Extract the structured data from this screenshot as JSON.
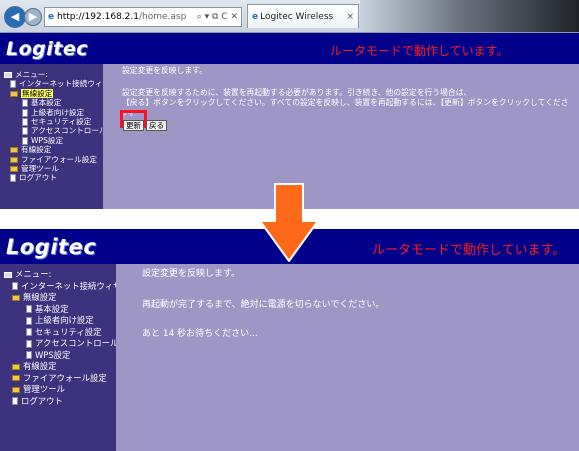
{
  "browser": {
    "url_host": "http://192.168.2.1",
    "url_path": "/home.asp",
    "address_tools": "⌕ ▾ ⧉ C ✕",
    "tab_title": "Logitec Wireless Router",
    "tab_close": "×"
  },
  "header": {
    "logo": "Logitec",
    "mode_message": "ルータモードで動作しています。"
  },
  "menu": [
    {
      "label": "メニュー:",
      "level": 0,
      "icon": "screen-icon"
    },
    {
      "label": "インターネット接続ウィザード",
      "level": 1,
      "icon": "doc-icon"
    },
    {
      "label": "無線設定",
      "level": 1,
      "icon": "folder-icon"
    },
    {
      "label": "基本設定",
      "level": 2,
      "icon": "doc-icon"
    },
    {
      "label": "上級者向け設定",
      "level": 2,
      "icon": "doc-icon"
    },
    {
      "label": "セキュリティ設定",
      "level": 2,
      "icon": "doc-icon"
    },
    {
      "label": "アクセスコントロール",
      "level": 2,
      "icon": "doc-icon"
    },
    {
      "label": "WPS設定",
      "level": 2,
      "icon": "doc-icon"
    },
    {
      "label": "有線設定",
      "level": 1,
      "icon": "folder-icon"
    },
    {
      "label": "ファイアウォール設定",
      "level": 1,
      "icon": "folder-icon"
    },
    {
      "label": "管理ツール",
      "level": 1,
      "icon": "folder-icon"
    },
    {
      "label": "ログアウト",
      "level": 1,
      "icon": "doc-icon"
    }
  ],
  "step1": {
    "title": "設定変更を反映します。",
    "body_line1": "設定変更を反映するために、装置を再起動する必要があります。引き続き、他の設定を行う場合は、",
    "body_line2": "【戻る】ボタンをクリックしてください。すべての設定を反映し、装置を再起動するには、【更新】ボタンをクリックしてください。",
    "update_button": "更新",
    "back_button": "戻る"
  },
  "step2": {
    "title": "設定変更を反映します。",
    "line1": "再起動が完了するまで、絶対に電源を切らないでください。",
    "line2": "あと 14 秒お待ちください..."
  },
  "colors": {
    "header_bg": "#00008b",
    "sidebar_bg": "#3c327e",
    "content_bg": "#9e97c6",
    "mode_text": "#ff1a1a",
    "highlight_box": "#ff1020",
    "arrow": "#ff6a1a"
  }
}
